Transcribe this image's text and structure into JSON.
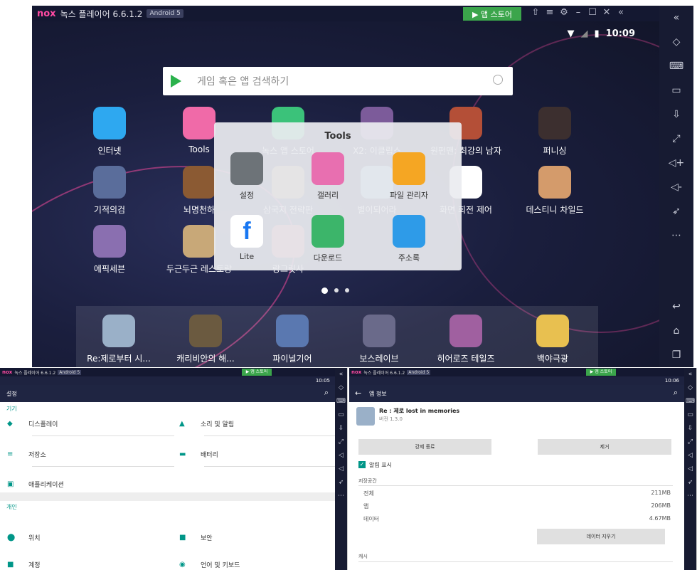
{
  "top": {
    "app_title": "녹스 플레이어 6.6.1.2",
    "android_badge": "Android 5",
    "store_button": "▶ 앱 스토어",
    "clock": "10:09",
    "search_placeholder": "게임 혹은 앱 검색하기",
    "apps": [
      {
        "label": "인터넷",
        "color": "#2ea8f0"
      },
      {
        "label": "Tools",
        "color": "#f06aa8"
      },
      {
        "label": "녹스 앱 스토어",
        "color": "#3bc27a"
      },
      {
        "label": "X2: 이클립스",
        "color": "#7c5b9a"
      },
      {
        "label": "원펀맨: 최강의 남자",
        "color": "#b44f37"
      },
      {
        "label": "퍼니싱",
        "color": "#3c2f2f"
      },
      {
        "label": "기적의검",
        "color": "#5a6d9b"
      },
      {
        "label": "뇌명천하",
        "color": "#8b5a33"
      },
      {
        "label": "삼국지 전략판",
        "color": "#9b7b5a"
      },
      {
        "label": "별이되어라",
        "color": "#6fa6c8"
      },
      {
        "label": "화면 회전 제어",
        "color": "#ffffff"
      },
      {
        "label": "데스티니 차일드",
        "color": "#d49b6b"
      },
      {
        "label": "에픽세븐",
        "color": "#8a6fb0"
      },
      {
        "label": "두근두근 레스토랑",
        "color": "#c8a878"
      },
      {
        "label": "랑그릿사",
        "color": "#b05a6a"
      }
    ],
    "folder": {
      "title": "Tools",
      "apps": [
        {
          "label": "설정",
          "color": "#6d7378"
        },
        {
          "label": "갤러리",
          "color": "#e86fb0"
        },
        {
          "label": "파일 관리자",
          "color": "#f5a623"
        },
        {
          "label": "Lite",
          "color": "#ffffff"
        },
        {
          "label": "다운로드",
          "color": "#3cb56a"
        },
        {
          "label": "주소록",
          "color": "#2e9be8"
        }
      ]
    },
    "dock": [
      {
        "label": "Re:제로부터 시...",
        "color": "#9ab0c8"
      },
      {
        "label": "캐리비안의 해...",
        "color": "#6b5a40"
      },
      {
        "label": "파이널기어",
        "color": "#5a78b0"
      },
      {
        "label": "보스레이브",
        "color": "#6a6a8a"
      },
      {
        "label": "히어로즈 테일즈",
        "color": "#a060a0"
      },
      {
        "label": "백야극광",
        "color": "#e8c050"
      }
    ],
    "sidebar_icons": [
      "collapse-icon",
      "diamond-icon",
      "keyboard-icon",
      "screen-icon",
      "import-icon",
      "fullscreen-icon",
      "volume-up-icon",
      "volume-down-icon",
      "rocket-icon",
      "more-icon",
      "back-icon",
      "home-icon",
      "recent-icon"
    ]
  },
  "left_pane": {
    "app_title": "녹스 플레이어 6.6.1.2",
    "android_badge": "Android 5",
    "store_button": "▶ 앱 스토어",
    "clock": "10:05",
    "header": "설정",
    "section_device": "기기",
    "section_personal": "개인",
    "items": [
      {
        "label": "디스플레이",
        "color": "#009688"
      },
      {
        "label": "소리 및 알림",
        "color": "#009688"
      },
      {
        "label": "저장소",
        "color": "#009688"
      },
      {
        "label": "배터리",
        "color": "#009688"
      },
      {
        "label": "애플리케이션",
        "color": "#009688"
      },
      {
        "label": "위치",
        "color": "#009688"
      },
      {
        "label": "보안",
        "color": "#009688"
      },
      {
        "label": "계정",
        "color": "#009688"
      },
      {
        "label": "언어 및 키보드",
        "color": "#009688"
      }
    ]
  },
  "right_pane": {
    "app_title": "녹스 플레이어 6.6.1.2",
    "android_badge": "Android 5",
    "store_button": "▶ 앱 스토어",
    "clock": "10:06",
    "header": "앱 정보",
    "app_name": "Re : 제로 lost in memories",
    "version": "버전 1.3.0",
    "force_stop": "강제 종료",
    "remove": "제거",
    "show_notifications": "알림 표시",
    "storage_heading": "저장공간",
    "storage_rows": [
      {
        "label": "전체",
        "value": "211MB"
      },
      {
        "label": "앱",
        "value": "206MB"
      },
      {
        "label": "데이터",
        "value": "4.67MB"
      }
    ],
    "clear_data": "데이터 지우기",
    "cache_heading": "캐시"
  }
}
